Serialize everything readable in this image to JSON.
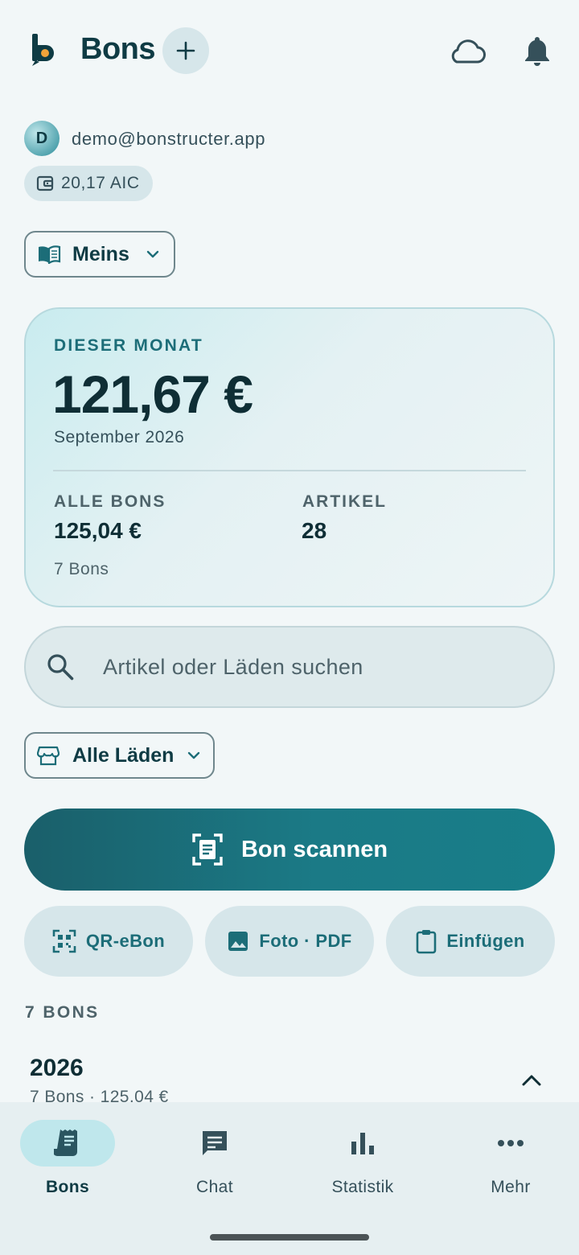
{
  "header": {
    "title": "Bons",
    "logo_icon": "bonstructer-logo-icon",
    "add_icon": "plus-icon",
    "cloud_icon": "cloud-icon",
    "bell_icon": "bell-icon"
  },
  "account": {
    "avatar_initial": "D",
    "email": "demo@bonstructer.app",
    "credits": "20,17 AIC",
    "credits_icon": "wallet-icon"
  },
  "book_selector": {
    "label": "Meins",
    "icon": "book-open-icon"
  },
  "month_card": {
    "label": "DIESER MONAT",
    "amount": "121,67 €",
    "month": "September 2026",
    "all_bons_label": "ALLE BONS",
    "all_bons_value": "125,04 €",
    "articles_label": "ARTIKEL",
    "articles_value": "28",
    "bons_count": "7 Bons"
  },
  "search": {
    "placeholder": "Artikel oder Läden suchen",
    "icon": "search-icon"
  },
  "store_filter": {
    "label": "Alle Läden",
    "icon": "store-icon"
  },
  "actions": {
    "scan_label": "Bon scannen",
    "qr_label": "QR-eBon",
    "photo_label": "Foto · PDF",
    "paste_label": "Einfügen"
  },
  "list": {
    "section_label": "7 BONS",
    "year": "2026",
    "year_summary": "7 Bons · 125,04 €"
  },
  "nav": {
    "items": [
      {
        "label": "Bons",
        "icon": "receipt-icon",
        "active": true
      },
      {
        "label": "Chat",
        "icon": "chat-icon",
        "active": false
      },
      {
        "label": "Statistik",
        "icon": "bar-chart-icon",
        "active": false
      },
      {
        "label": "Mehr",
        "icon": "more-horizontal-icon",
        "active": false
      }
    ]
  },
  "colors": {
    "accent": "#1b7a86",
    "primary_text": "#0f2e35",
    "background": "#f2f7f8",
    "chip_bg": "#d6e6ea"
  }
}
